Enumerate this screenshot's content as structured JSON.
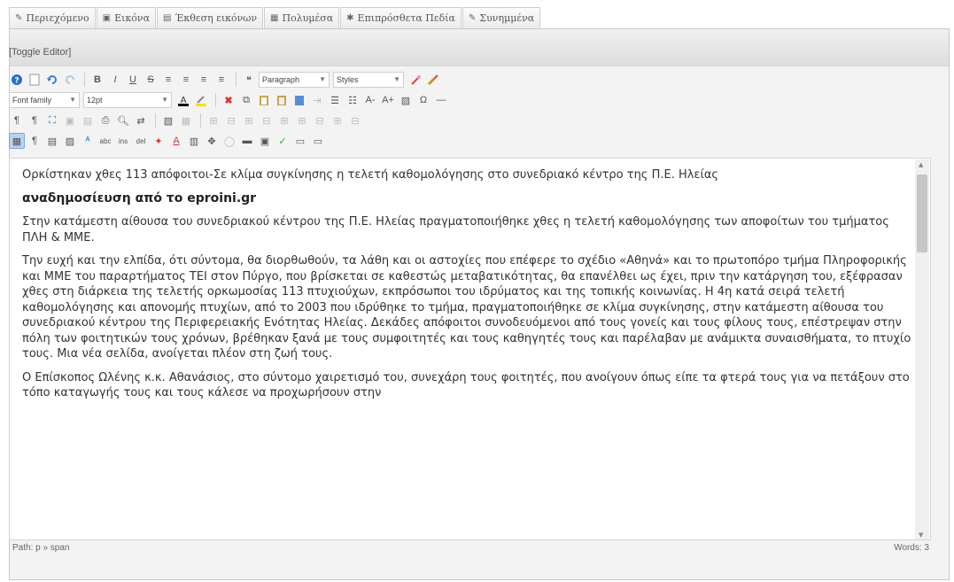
{
  "tabs": [
    {
      "icon": "✎",
      "label": "Περιεχόμενο"
    },
    {
      "icon": "▣",
      "label": "Εικόνα"
    },
    {
      "icon": "▤",
      "label": "Έκθεση εικόνων"
    },
    {
      "icon": "▦",
      "label": "Πολυμέσα"
    },
    {
      "icon": "✱",
      "label": "Επιπρόσθετα Πεδία"
    },
    {
      "icon": "✎",
      "label": "Συνημμένα"
    }
  ],
  "editor": {
    "toggle_label": "[Toggle Editor]",
    "format_select": "Paragraph",
    "styles_select": "Styles",
    "font_family_select": "Font family",
    "font_size_select": "12pt"
  },
  "content": {
    "intro": "Ορκίστηκαν χθες 113 απόφοιτοι-Σε κλίμα συγκίνησης η τελετή καθομολόγησης στο συνεδριακό κέντρο της Π.Ε. Ηλείας",
    "heading": "αναδημοσίευση από το eproini.gr",
    "p1": "Στην κατάμεστη αίθουσα του συνεδριακού κέντρου της Π.Ε. Ηλείας πραγματοποιήθηκε χθες η τελετή καθομολόγησης των αποφοίτων του τμήματος ΠΛΗ & ΜΜΕ.",
    "p2": "Την ευχή και την ελπίδα, ότι σύντομα, θα διορθωθούν, τα λάθη και οι αστοχίες που επέφερε το σχέδιο «Αθηνά» και το πρωτοπόρο τμήμα Πληροφορικής και ΜΜΕ του παραρτήματος ΤΕΙ στον Πύργο, που βρίσκεται σε καθεστώς μεταβατικότητας, θα επανέλθει ως έχει, πριν την κατάργηση του, εξέφρασαν χθες στη διάρκεια της τελετής ορκωμοσίας 113 πτυχιούχων, εκπρόσωποι του ιδρύματος και της τοπικής κοινωνίας. Η 4η κατά σειρά τελετή καθομολόγησης και απονομής πτυχίων, από το 2003 που ιδρύθηκε το τμήμα, πραγματοποιήθηκε σε κλίμα συγκίνησης, στην κατάμεστη αίθουσα του συνεδριακού κέντρου της Περιφερειακής Ενότητας Ηλείας. Δεκάδες απόφοιτοι συνοδευόμενοι από τους γονείς και τους φίλους τους, επέστρεψαν στην πόλη των φοιτητικών τους χρόνων, βρέθηκαν ξανά με τους συμφοιτητές και τους καθηγητές τους και παρέλαβαν με ανάμικτα συναισθήματα, το πτυχίο τους. Μια νέα σελίδα, ανοίγεται πλέον στη ζωή τους.",
    "p3": "Ο Επίσκοπος Ωλένης κ.κ. Αθανάσιος, στο σύντομο χαιρετισμό του, συνεχάρη τους φοιτητές, που ανοίγουν όπως είπε τα φτερά τους για να πετάξουν στο τόπο καταγωγής τους και τους κάλεσε να προχωρήσουν στην"
  },
  "status": {
    "path": "Path: p » span",
    "words": "Words: 3"
  }
}
